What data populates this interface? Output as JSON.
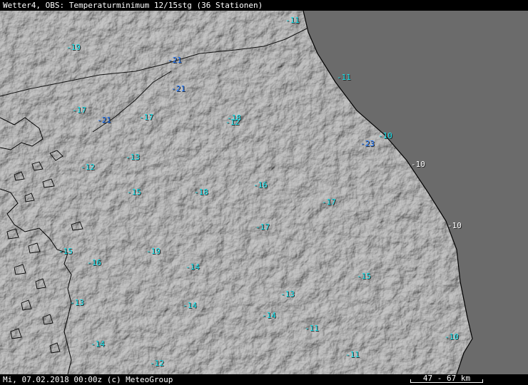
{
  "title": "Wetter4, OBS: Temperaturminimum 12/15stg (36 Stationen)",
  "footer": "Mi, 07.02.2018 00:00z (c) MeteoGroup",
  "scale_label": "47 - 67 km",
  "colors": {
    "sea": "#6b6b6b",
    "land": "#7a7a7a",
    "cyan_label": "#19e6f0",
    "blue_label": "#1e78ff",
    "white_label": "#ffffff"
  },
  "stations": [
    {
      "value": "-11",
      "color": "cyan"
    },
    {
      "value": "-19",
      "color": "cyan"
    },
    {
      "value": "-21",
      "color": "blue"
    },
    {
      "value": "-11",
      "color": "cyan"
    },
    {
      "value": "-21",
      "color": "blue"
    },
    {
      "value": "-17",
      "color": "cyan"
    },
    {
      "value": "-17",
      "color": "cyan"
    },
    {
      "value": "-21",
      "color": "blue"
    },
    {
      "value": "-18",
      "color": "cyan"
    },
    {
      "value": "-12",
      "color": "cyan"
    },
    {
      "value": "-10",
      "color": "cyan"
    },
    {
      "value": "-23",
      "color": "blue"
    },
    {
      "value": "-13",
      "color": "cyan"
    },
    {
      "value": "-12",
      "color": "cyan"
    },
    {
      "value": "-10",
      "color": "white"
    },
    {
      "value": "-16",
      "color": "cyan"
    },
    {
      "value": "-15",
      "color": "cyan"
    },
    {
      "value": "-18",
      "color": "cyan"
    },
    {
      "value": "-17",
      "color": "cyan"
    },
    {
      "value": "-17",
      "color": "cyan"
    },
    {
      "value": "-10",
      "color": "white"
    },
    {
      "value": "-15",
      "color": "cyan"
    },
    {
      "value": "-19",
      "color": "cyan"
    },
    {
      "value": "-16",
      "color": "cyan"
    },
    {
      "value": "-14",
      "color": "cyan"
    },
    {
      "value": "-15",
      "color": "cyan"
    },
    {
      "value": "-13",
      "color": "cyan"
    },
    {
      "value": "-13",
      "color": "cyan"
    },
    {
      "value": "-14",
      "color": "cyan"
    },
    {
      "value": "-14",
      "color": "cyan"
    },
    {
      "value": "-11",
      "color": "cyan"
    },
    {
      "value": "-10",
      "color": "cyan"
    },
    {
      "value": "-14",
      "color": "cyan"
    },
    {
      "value": "-11",
      "color": "cyan"
    },
    {
      "value": "-12",
      "color": "cyan"
    }
  ]
}
